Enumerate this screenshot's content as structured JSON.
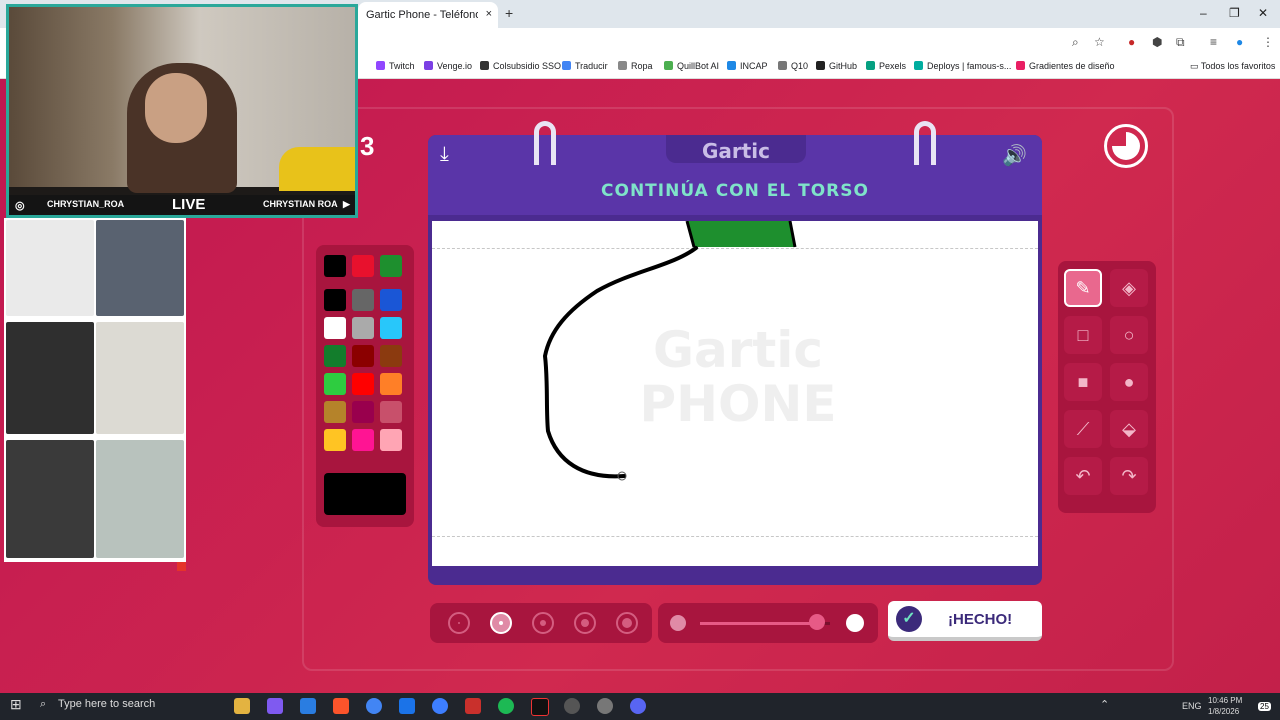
{
  "browser": {
    "tab_title": "Gartic Phone - Teléfono Descom",
    "tab_close": "×",
    "new_tab": "+",
    "window_controls": [
      "–",
      "❐",
      "✕"
    ]
  },
  "bookmarks": [
    {
      "label": "Twitch",
      "color": "#9146ff"
    },
    {
      "label": "Venge.io",
      "color": "#7b3fe4"
    },
    {
      "label": "Colsubsidio SSO",
      "color": "#333333"
    },
    {
      "label": "Traducir",
      "color": "#4285f4"
    },
    {
      "label": "Ropa",
      "color": "#888888"
    },
    {
      "label": "QuillBot AI",
      "color": "#4caf50"
    },
    {
      "label": "INCAP",
      "color": "#1e88e5"
    },
    {
      "label": "Q10",
      "color": "#777777"
    },
    {
      "label": "GitHub",
      "color": "#222222"
    },
    {
      "label": "Pexels",
      "color": "#05a081"
    },
    {
      "label": "Deploys | famous-s...",
      "color": "#00ad9f"
    },
    {
      "label": "Gradientes de diseño",
      "color": "#e91e63"
    }
  ],
  "bookmarks_all": "Todos los favoritos",
  "game": {
    "round_number": "3",
    "logo": "Gartic",
    "prompt": "CONTINÚA CON EL TORSO",
    "watermark_line1": "Gartic",
    "watermark_line2": "PHONE",
    "done_label": "¡HECHO!",
    "colors": [
      "#000000",
      "#e8112d",
      "#1e8f2e",
      "#000000",
      "#666666",
      "#1a56d6",
      "#ffffff",
      "#aaaaaa",
      "#28c7fa",
      "#137d2c",
      "#8b0000",
      "#8b3a0f",
      "#2ecc40",
      "#ff0000",
      "#ff7f27",
      "#b5832a",
      "#99004d",
      "#c8506b",
      "#ffc423",
      "#ff1493",
      "#ffa5b4"
    ],
    "current_color": "#000000",
    "brush_sizes": 5,
    "selected_size": 2,
    "opacity": 0.9
  },
  "stream": {
    "handle_left": "CHRYSTIAN_ROA",
    "live": "LIVE",
    "handle_right": "CHRYSTIAN ROA"
  },
  "taskbar": {
    "search": "Type here to search",
    "lang": "ENG",
    "time": "10:46 PM",
    "date": "1/8/2026",
    "notif": "25"
  }
}
